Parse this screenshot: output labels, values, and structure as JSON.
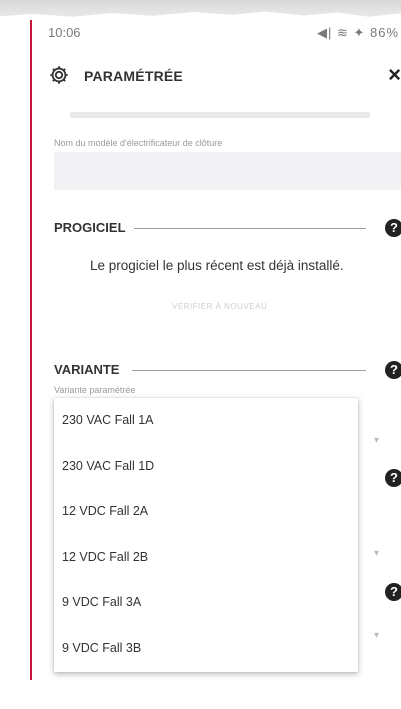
{
  "status_bar": {
    "time": "10:06",
    "indicators": "◀| ≋ ✦ 86%"
  },
  "header": {
    "title": "PARAMÉTRÉE",
    "close_symbol": "×",
    "gear_icon": "gear-icon"
  },
  "model": {
    "label": "Nom du modèle d'électrificateur de clôture",
    "value": ""
  },
  "firmware": {
    "title": "PROGICIEL",
    "help_symbol": "?",
    "message": "Le progiciel le plus récent est déjà installé.",
    "button_label": "VÉRIFIER À NOUVEAU"
  },
  "variant": {
    "title": "VARIANTE",
    "help_symbol": "?",
    "field_label": "Variante paramétrée",
    "options": [
      "230 VAC Fall 1A",
      "230 VAC Fall 1D",
      "12 VDC Fall 2A",
      "12 VDC Fall 2B",
      "9 VDC Fall 3A",
      "9 VDC Fall 3B"
    ]
  },
  "colors": {
    "accent_rule": "#c4163a",
    "help_bg": "#222222",
    "field_bg": "#f2f2f4"
  }
}
